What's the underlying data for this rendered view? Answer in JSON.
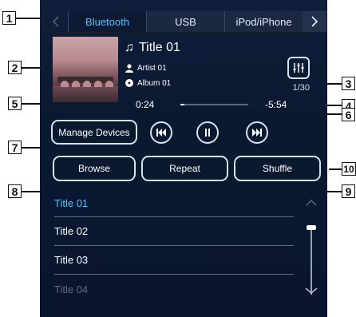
{
  "tabs": {
    "items": [
      {
        "label": "Bluetooth",
        "active": true
      },
      {
        "label": "USB",
        "active": false
      },
      {
        "label": "iPod/iPhone",
        "active": false
      }
    ],
    "prev_icon": "chevron-left-icon",
    "next_icon": "chevron-right-icon"
  },
  "now_playing": {
    "title": "Title 01",
    "artist": "Artist 01",
    "album": "Album 01",
    "track_count": "1/30",
    "elapsed": "0:24",
    "remaining": "-5:54",
    "progress": 0.06
  },
  "controls": {
    "manage_devices": "Manage Devices",
    "browse": "Browse",
    "repeat": "Repeat",
    "shuffle": "Shuffle"
  },
  "playlist": [
    {
      "title": "Title 01",
      "current": true
    },
    {
      "title": "Title 02",
      "current": false
    },
    {
      "title": "Title 03",
      "current": false
    },
    {
      "title": "Title 04",
      "current": false
    }
  ],
  "callouts": [
    "1",
    "2",
    "3",
    "4",
    "5",
    "6",
    "7",
    "8",
    "9",
    "10"
  ],
  "colors": {
    "accent": "#4fc3ff",
    "background": "#0a1830",
    "border": "#d7e2f0"
  }
}
